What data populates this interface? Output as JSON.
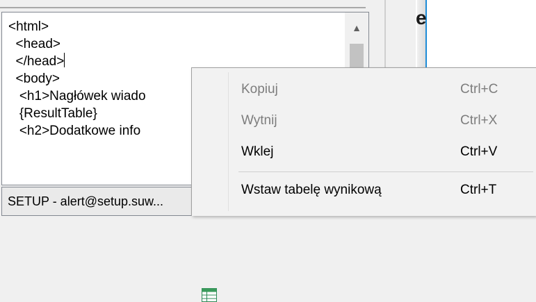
{
  "editor": {
    "lines": [
      "<html>",
      "  <head>",
      "  </head>",
      "  <body>",
      "   <h1>Nagłówek wiado",
      "   {ResultTable}",
      "   <h2>Dodatkowe info"
    ],
    "scroll_up_glyph": "▲"
  },
  "statusbar": {
    "text": "SETUP - alert@setup.suw..."
  },
  "right_panel": {
    "glyph": "e"
  },
  "context_menu": {
    "items": [
      {
        "label": "Kopiuj",
        "shortcut": "Ctrl+C",
        "enabled": false
      },
      {
        "label": "Wytnij",
        "shortcut": "Ctrl+X",
        "enabled": false
      },
      {
        "label": "Wklej",
        "shortcut": "Ctrl+V",
        "enabled": true
      },
      {
        "label": "Wstaw tabelę wynikową",
        "shortcut": "Ctrl+T",
        "enabled": true,
        "icon": "table-icon"
      }
    ]
  }
}
